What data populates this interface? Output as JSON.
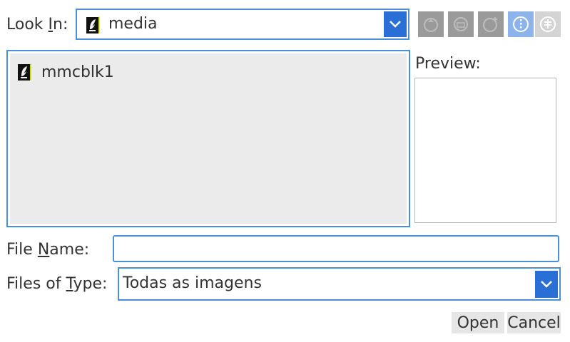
{
  "look_in": {
    "label_prefix": "Look ",
    "label_mnemonic": "I",
    "label_suffix": "n:",
    "value": "media"
  },
  "toolbar": {
    "buttons": [
      {
        "name": "up-one-level",
        "state": "disabled",
        "icon": "up-folder-icon"
      },
      {
        "name": "home",
        "state": "disabled",
        "icon": "home-icon"
      },
      {
        "name": "new-folder",
        "state": "disabled",
        "icon": "new-folder-icon"
      },
      {
        "name": "list-view",
        "state": "active",
        "icon": "list-view-icon"
      },
      {
        "name": "details-view",
        "state": "inactive",
        "icon": "details-view-icon"
      }
    ]
  },
  "file_list": {
    "items": [
      {
        "name": "mmcblk1",
        "icon": "drive-icon"
      }
    ]
  },
  "preview": {
    "label": "Preview:"
  },
  "file_name": {
    "label_prefix": "File ",
    "label_mnemonic": "N",
    "label_suffix": "ame:",
    "value": ""
  },
  "files_of_type": {
    "label_prefix": "Files of ",
    "label_mnemonic": "T",
    "label_suffix": "ype:",
    "value": "Todas as imagens"
  },
  "actions": {
    "open": "Open",
    "cancel": "Cancel"
  },
  "colors": {
    "accent": "#4a90d9",
    "arrow": "#2a6fd6",
    "list_bg": "#ebebeb"
  }
}
